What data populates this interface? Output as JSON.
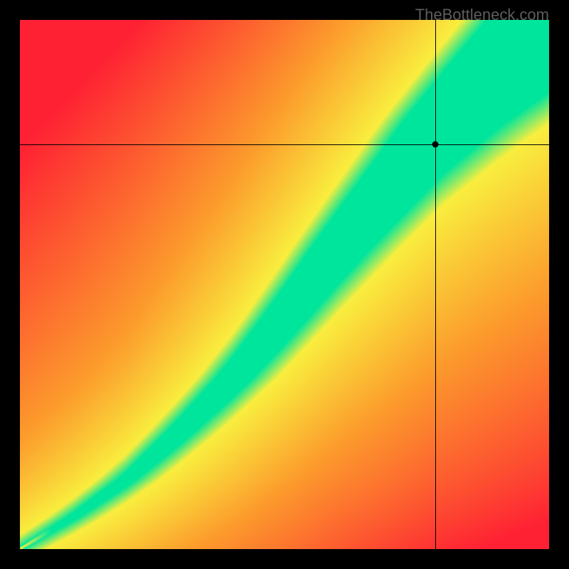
{
  "watermark": "TheBottleneck.com",
  "chart_data": {
    "type": "heatmap",
    "title": "",
    "xlabel": "",
    "ylabel": "",
    "xlim": [
      0,
      1
    ],
    "ylim": [
      0,
      1
    ],
    "marker": {
      "x": 0.785,
      "y": 0.235
    },
    "crosshair": {
      "x": 0.785,
      "y": 0.235
    },
    "color_scale": {
      "optimal": "#00E59C",
      "near": "#F9EE3E",
      "moderate": "#FC9B2C",
      "poor": "#FE2033"
    },
    "ridge_points": [
      {
        "x": 0.0,
        "y": 1.0
      },
      {
        "x": 0.1,
        "y": 0.94
      },
      {
        "x": 0.2,
        "y": 0.87
      },
      {
        "x": 0.3,
        "y": 0.78
      },
      {
        "x": 0.4,
        "y": 0.68
      },
      {
        "x": 0.5,
        "y": 0.56
      },
      {
        "x": 0.6,
        "y": 0.43
      },
      {
        "x": 0.7,
        "y": 0.31
      },
      {
        "x": 0.8,
        "y": 0.19
      },
      {
        "x": 0.9,
        "y": 0.09
      },
      {
        "x": 1.0,
        "y": 0.0
      }
    ],
    "ridge_width_points": [
      {
        "x": 0.0,
        "w": 0.003
      },
      {
        "x": 0.2,
        "w": 0.015
      },
      {
        "x": 0.4,
        "w": 0.035
      },
      {
        "x": 0.6,
        "w": 0.06
      },
      {
        "x": 0.8,
        "w": 0.09
      },
      {
        "x": 1.0,
        "w": 0.14
      }
    ]
  }
}
